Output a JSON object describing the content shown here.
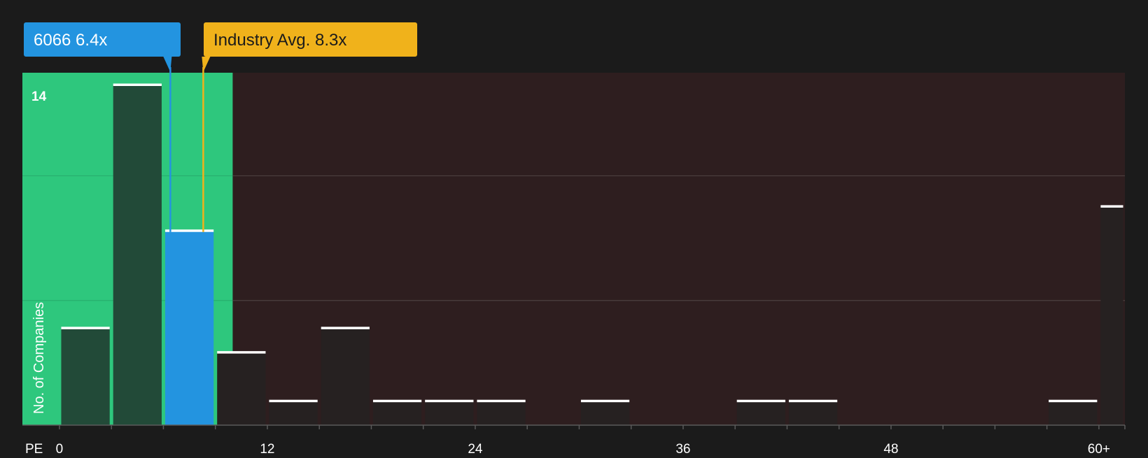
{
  "chart_data": {
    "type": "bar",
    "xlabel": "PE",
    "ylabel": "No. of Companies",
    "x_tick_labels": [
      "0",
      "12",
      "24",
      "36",
      "48",
      "60+"
    ],
    "x_ticks": [
      0,
      12,
      24,
      36,
      48,
      60
    ],
    "y_tick_labels": [
      "14"
    ],
    "ylim": [
      0,
      14
    ],
    "xlim": [
      -2.14,
      61.5
    ],
    "grid": true,
    "bin_width": 3,
    "bins": [
      {
        "x0": 0,
        "x1": 3,
        "value": 4
      },
      {
        "x0": 3,
        "x1": 6,
        "value": 14
      },
      {
        "x0": 6,
        "x1": 9,
        "value": 8,
        "highlight": true
      },
      {
        "x0": 9,
        "x1": 12,
        "value": 3
      },
      {
        "x0": 12,
        "x1": 15,
        "value": 1
      },
      {
        "x0": 15,
        "x1": 18,
        "value": 4
      },
      {
        "x0": 18,
        "x1": 21,
        "value": 1
      },
      {
        "x0": 21,
        "x1": 24,
        "value": 1
      },
      {
        "x0": 24,
        "x1": 27,
        "value": 1
      },
      {
        "x0": 27,
        "x1": 30,
        "value": 0
      },
      {
        "x0": 30,
        "x1": 33,
        "value": 1
      },
      {
        "x0": 33,
        "x1": 36,
        "value": 0
      },
      {
        "x0": 36,
        "x1": 39,
        "value": 0
      },
      {
        "x0": 39,
        "x1": 42,
        "value": 1
      },
      {
        "x0": 42,
        "x1": 45,
        "value": 1
      },
      {
        "x0": 45,
        "x1": 48,
        "value": 0
      },
      {
        "x0": 48,
        "x1": 51,
        "value": 0
      },
      {
        "x0": 51,
        "x1": 54,
        "value": 0
      },
      {
        "x0": 54,
        "x1": 57,
        "value": 0
      },
      {
        "x0": 57,
        "x1": 60,
        "value": 1
      },
      {
        "x0": 60,
        "x1": 61.5,
        "value": 9
      }
    ],
    "company_marker": {
      "label": "6066 6.4x",
      "value": 6.4
    },
    "industry_marker": {
      "label": "Industry Avg. 8.3x",
      "value": 8.3
    },
    "good_value_limit": 10.0
  },
  "colors": {
    "background": "#1b1b1b",
    "good_zone": "#2ec77d",
    "bad_zone": "#2e1e1f",
    "bar_in_good_zone": "#224a38",
    "bar_default": "#262121",
    "bar_highlight": "#2394e0",
    "company_marker": "#2394e0",
    "industry_marker": "#f0b21b",
    "bar_cap": "#ffffff",
    "grid": "#4c4040",
    "text": "#ffffff",
    "industry_text": "#1b1b1b"
  }
}
